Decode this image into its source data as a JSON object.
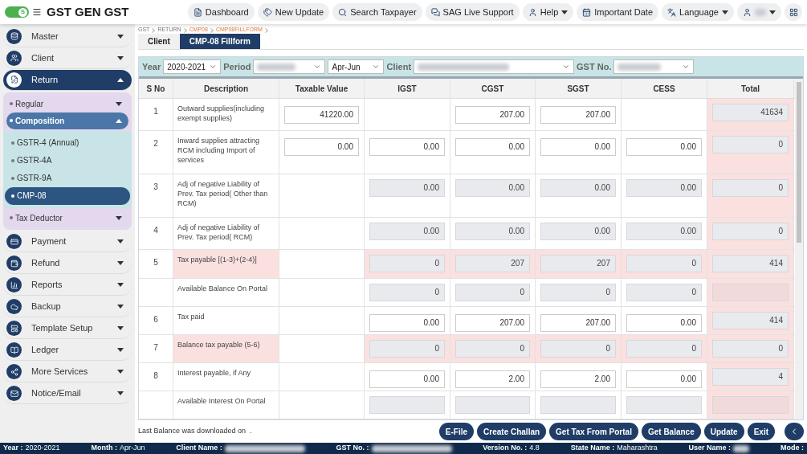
{
  "header": {
    "toggle": "S",
    "toggle_on": true,
    "title": "GST GEN GST",
    "buttons": [
      {
        "label": "Dashboard",
        "kind": "dashboard",
        "caret": false
      },
      {
        "label": "New Update",
        "kind": "update",
        "caret": false
      },
      {
        "label": "Search Taxpayer",
        "kind": "search",
        "caret": false
      },
      {
        "label": "SAG Live Support",
        "kind": "support",
        "caret": false
      },
      {
        "label": "Help",
        "kind": "user",
        "caret": true
      },
      {
        "label": "Important Date",
        "kind": "calendar",
        "caret": false
      },
      {
        "label": "Language",
        "kind": "language",
        "caret": true
      }
    ]
  },
  "sidebar": {
    "items": [
      {
        "label": "Master",
        "expanded": false,
        "selected": false
      },
      {
        "label": "Client",
        "expanded": false,
        "selected": false
      },
      {
        "label": "Return",
        "expanded": true,
        "selected": true,
        "children": [
          {
            "label": "Regular",
            "expanded": false,
            "selected": false
          },
          {
            "label": "Composition",
            "expanded": true,
            "selected": true,
            "children": [
              {
                "label": "GSTR-4 (Annual)",
                "selected": false
              },
              {
                "label": "GSTR-4A",
                "selected": false
              },
              {
                "label": "GSTR-9A",
                "selected": false
              },
              {
                "label": "CMP-08",
                "selected": true
              }
            ]
          },
          {
            "label": "Tax Deductor",
            "expanded": false,
            "selected": false
          }
        ]
      },
      {
        "label": "Payment",
        "expanded": false,
        "selected": false
      },
      {
        "label": "Refund",
        "expanded": false,
        "selected": false
      },
      {
        "label": "Reports",
        "expanded": false,
        "selected": false
      },
      {
        "label": "Backup",
        "expanded": false,
        "selected": false
      },
      {
        "label": "Template Setup",
        "expanded": false,
        "selected": false
      },
      {
        "label": "Ledger",
        "expanded": false,
        "selected": false
      },
      {
        "label": "More Services",
        "expanded": false,
        "selected": false
      },
      {
        "label": "Notice/Email",
        "expanded": false,
        "selected": false
      }
    ]
  },
  "breadcrumb": [
    {
      "label": "GST",
      "current": false
    },
    {
      "label": "RETURN",
      "current": false
    },
    {
      "label": "CMP08",
      "current": true
    },
    {
      "label": "CMP08FILLFORM",
      "current": true
    }
  ],
  "tabs": [
    {
      "label": "Client",
      "selected": false
    },
    {
      "label": "CMP-08 Fillform",
      "selected": true
    }
  ],
  "filters": [
    {
      "label": "Year",
      "value": "2020-2021"
    },
    {
      "label": "Period"
    },
    {
      "value": "Apr-Jun"
    },
    {
      "label": "Client"
    },
    {
      "label": "GST No."
    }
  ],
  "table": {
    "columns": [
      "S No",
      "Description",
      "Taxable Value",
      "IGST",
      "CGST",
      "SGST",
      "CESS",
      "Total"
    ],
    "rows": [
      {
        "highlight": false,
        "cells": [
          {
            "kind": "sno",
            "value": "1"
          },
          {
            "kind": "desc",
            "value": "Outward supplies(including exempt supplies)"
          },
          {
            "kind": "input",
            "value": "41220.00"
          },
          {
            "kind": "empty"
          },
          {
            "kind": "input",
            "value": "207.00"
          },
          {
            "kind": "input",
            "value": "207.00"
          },
          {
            "kind": "empty"
          },
          {
            "kind": "readonly",
            "value": "41634"
          }
        ]
      },
      {
        "highlight": false,
        "cells": [
          {
            "kind": "sno",
            "value": "2"
          },
          {
            "kind": "desc",
            "value": "Inward supplies attracting RCM including Import of services"
          },
          {
            "kind": "input",
            "value": "0.00"
          },
          {
            "kind": "input",
            "value": "0.00"
          },
          {
            "kind": "input",
            "value": "0.00"
          },
          {
            "kind": "input",
            "value": "0.00"
          },
          {
            "kind": "input",
            "value": "0.00"
          },
          {
            "kind": "readonly",
            "value": "0"
          }
        ]
      },
      {
        "highlight": false,
        "cells": [
          {
            "kind": "sno",
            "value": "3"
          },
          {
            "kind": "desc",
            "value": "Adj of negative Liability of Prev. Tax period( Other than RCM)"
          },
          {
            "kind": "empty"
          },
          {
            "kind": "readonly",
            "value": "0.00"
          },
          {
            "kind": "readonly",
            "value": "0.00"
          },
          {
            "kind": "readonly",
            "value": "0.00"
          },
          {
            "kind": "readonly",
            "value": "0.00"
          },
          {
            "kind": "readonly",
            "value": "0"
          }
        ]
      },
      {
        "highlight": false,
        "cells": [
          {
            "kind": "sno",
            "value": "4"
          },
          {
            "kind": "desc",
            "value": "Adj of negative Liability of Prev. Tax period( RCM)"
          },
          {
            "kind": "empty"
          },
          {
            "kind": "readonly",
            "value": "0.00"
          },
          {
            "kind": "readonly",
            "value": "0.00"
          },
          {
            "kind": "readonly",
            "value": "0.00"
          },
          {
            "kind": "readonly",
            "value": "0.00"
          },
          {
            "kind": "readonly",
            "value": "0"
          }
        ]
      },
      {
        "highlight": true,
        "cells": [
          {
            "kind": "sno",
            "value": "5"
          },
          {
            "kind": "desc",
            "value": "Tax payable [(1-3)+(2-4)]"
          },
          {
            "kind": "empty"
          },
          {
            "kind": "readonly",
            "value": "0"
          },
          {
            "kind": "readonly",
            "value": "207"
          },
          {
            "kind": "readonly",
            "value": "207"
          },
          {
            "kind": "readonly",
            "value": "0"
          },
          {
            "kind": "readonly",
            "value": "414"
          }
        ]
      },
      {
        "highlight": false,
        "cells": [
          {
            "kind": "empty"
          },
          {
            "kind": "desc",
            "value": "Available Balance On Portal"
          },
          {
            "kind": "empty"
          },
          {
            "kind": "readonly",
            "value": "0"
          },
          {
            "kind": "readonly",
            "value": "0"
          },
          {
            "kind": "readonly",
            "value": "0"
          },
          {
            "kind": "readonly",
            "value": "0"
          },
          {
            "kind": "blank"
          }
        ]
      },
      {
        "highlight": false,
        "cells": [
          {
            "kind": "sno",
            "value": "6"
          },
          {
            "kind": "desc",
            "value": "Tax paid"
          },
          {
            "kind": "empty"
          },
          {
            "kind": "input",
            "value": "0.00"
          },
          {
            "kind": "input",
            "value": "207.00"
          },
          {
            "kind": "input",
            "value": "207.00"
          },
          {
            "kind": "input",
            "value": "0.00"
          },
          {
            "kind": "readonly",
            "value": "414"
          }
        ]
      },
      {
        "highlight": true,
        "cells": [
          {
            "kind": "sno",
            "value": "7"
          },
          {
            "kind": "desc",
            "value": "Balance tax payable (5-6)"
          },
          {
            "kind": "empty"
          },
          {
            "kind": "readonly",
            "value": "0"
          },
          {
            "kind": "readonly",
            "value": "0"
          },
          {
            "kind": "readonly",
            "value": "0"
          },
          {
            "kind": "readonly",
            "value": "0"
          },
          {
            "kind": "readonly",
            "value": "0"
          }
        ]
      },
      {
        "highlight": false,
        "cells": [
          {
            "kind": "sno",
            "value": "8"
          },
          {
            "kind": "desc",
            "value": "Interest payable, if Any"
          },
          {
            "kind": "empty"
          },
          {
            "kind": "input",
            "value": "0.00"
          },
          {
            "kind": "input",
            "value": "2.00"
          },
          {
            "kind": "input",
            "value": "2.00"
          },
          {
            "kind": "input",
            "value": "0.00"
          },
          {
            "kind": "readonly",
            "value": "4"
          }
        ]
      },
      {
        "highlight": false,
        "cells": [
          {
            "kind": "empty"
          },
          {
            "kind": "desc",
            "value": "Available Interest On Portal"
          },
          {
            "kind": "empty"
          },
          {
            "kind": "blank"
          },
          {
            "kind": "blank"
          },
          {
            "kind": "blank"
          },
          {
            "kind": "blank"
          },
          {
            "kind": "blank"
          }
        ]
      }
    ]
  },
  "footer": {
    "note": "Last Balance was downloaded on  .",
    "buttons": [
      "E-File",
      "Create Challan",
      "Get Tax From Portal",
      "Get Balance",
      "Update",
      "Exit"
    ]
  },
  "status_bar": [
    {
      "label": "Year :",
      "value": "2020-2021"
    },
    {
      "label": "Month :",
      "value": "Apr-Jun"
    },
    {
      "label": "Client Name :"
    },
    {
      "label": "GST No. :"
    },
    {
      "label": "Version No. :",
      "value": "4.8"
    },
    {
      "label": "State Name :",
      "value": "Maharashtra"
    },
    {
      "label": "User Name :"
    },
    {
      "label": "Mode :"
    }
  ]
}
